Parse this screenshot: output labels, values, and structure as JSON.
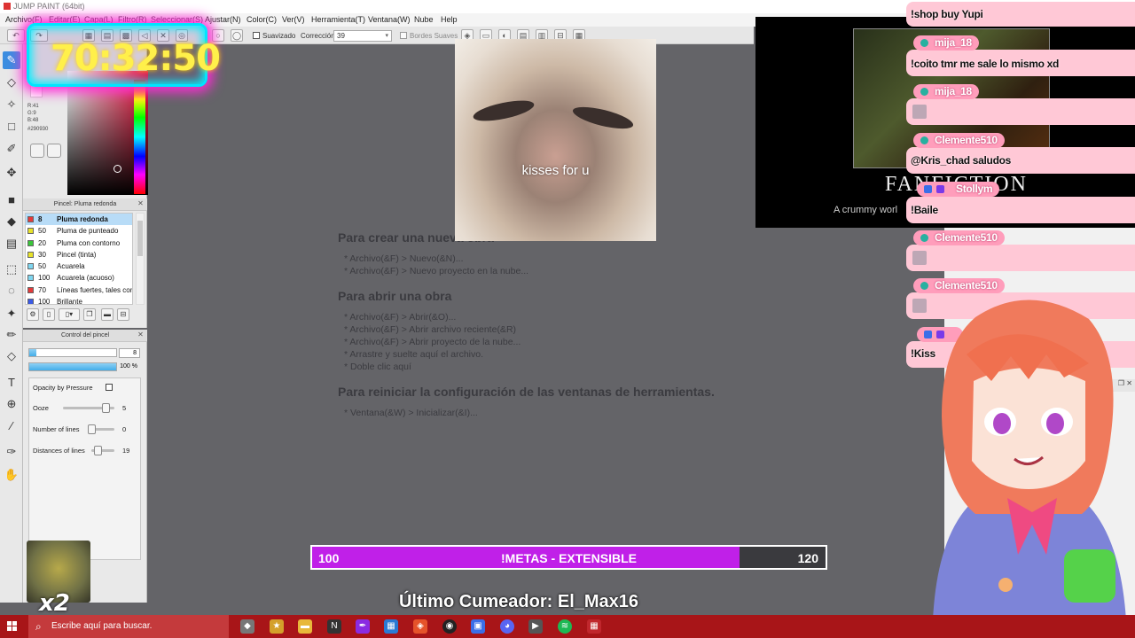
{
  "window": {
    "title": "JUMP PAINT (64bit)"
  },
  "menu": [
    "Archivo(F)",
    "Editar(E)",
    "Capa(L)",
    "Filtro(R)",
    "Seleccionar(S)",
    "Ajustar(N)",
    "Color(C)",
    "Ver(V)",
    "Herramienta(T)",
    "Ventana(W)",
    "Nube",
    "Help"
  ],
  "options": {
    "smooth_label": "Suavizado",
    "correction_label": "Corrección",
    "correction_value": "39",
    "edges_label": "Bordes Suaves"
  },
  "color": {
    "r": "R:41",
    "g": "G:9",
    "b": "B:48",
    "hex": "#290930"
  },
  "brush_panel": {
    "title": "Pincel: Pluma redonda",
    "items": [
      {
        "size": "8",
        "name": "Pluma redonda",
        "color": "#e53a3a"
      },
      {
        "size": "50",
        "name": "Pluma de punteado",
        "color": "#e8e32a"
      },
      {
        "size": "20",
        "name": "Pluma con contorno",
        "color": "#3ac63a"
      },
      {
        "size": "30",
        "name": "Pincel (tinta)",
        "color": "#e8e32a"
      },
      {
        "size": "50",
        "name": "Acuarela",
        "color": "#7fd6f0"
      },
      {
        "size": "100",
        "name": "Acuarela (acuoso)",
        "color": "#7fd6f0"
      },
      {
        "size": "70",
        "name": "Líneas fuertes, tales como",
        "color": "#e53a3a"
      },
      {
        "size": "100",
        "name": "Brillante",
        "color": "#3a5ae5"
      }
    ]
  },
  "brush_control": {
    "title": "Control del pincel",
    "size_value": "8",
    "size_level": 0.08,
    "opacity_value": "100 %",
    "opacity_level": 1.0,
    "opacity_by_pressure": "Opacity by Pressure",
    "sliders": [
      {
        "label": "Ooze",
        "value": "5",
        "level": 0.9
      },
      {
        "label": "Number of lines",
        "value": "0",
        "level": 0.0
      },
      {
        "label": "Distances of lines",
        "value": "19",
        "level": 0.15
      }
    ]
  },
  "timer": "70:32:50",
  "gif_caption": "kisses for u",
  "help": {
    "sections": [
      {
        "heading": "Para crear una nueva obra",
        "items": [
          "* Archivo(&F) > Nuevo(&N)...",
          "* Archivo(&F) > Nuevo proyecto en la nube..."
        ]
      },
      {
        "heading": "Para abrir una obra",
        "items": [
          "* Archivo(&F) > Abrir(&O)...",
          "* Archivo(&F) > Abrir archivo reciente(&R)",
          "* Archivo(&F) > Abrir proyecto de la nube...",
          "* Arrastre y suelte aquí el archivo.",
          "* Doble clic aquí"
        ]
      },
      {
        "heading": "Para reiniciar la configuración de las ventanas de herramientas.",
        "items": [
          "* Ventana(&W) > Inicializar(&I)..."
        ]
      }
    ]
  },
  "video": {
    "title": "FANFICTION",
    "subtitle": "A crummy worl"
  },
  "chat": [
    {
      "user": "",
      "text": "!shop buy Yupi"
    },
    {
      "user": "mija_18",
      "text": "!coito tmr me sale lo mismo xd"
    },
    {
      "user": "mija_18",
      "text": ""
    },
    {
      "user": "Clemente510",
      "text": "@Kris_chad saludos"
    },
    {
      "user": "Stollym",
      "text": "!Baile"
    },
    {
      "user": "Clemente510",
      "text": ""
    },
    {
      "user": "Clemente510",
      "text": ""
    },
    {
      "user": "",
      "text": "!Kiss"
    }
  ],
  "metas": {
    "current": "100",
    "label": "!METAS - EXTENSIBLE",
    "target": "120",
    "progress": 0.8333
  },
  "last_cum": "Último Cumeador: El_Max16",
  "dog_counter": "x2",
  "taskbar": {
    "search_placeholder": "Escribe aquí para buscar."
  }
}
